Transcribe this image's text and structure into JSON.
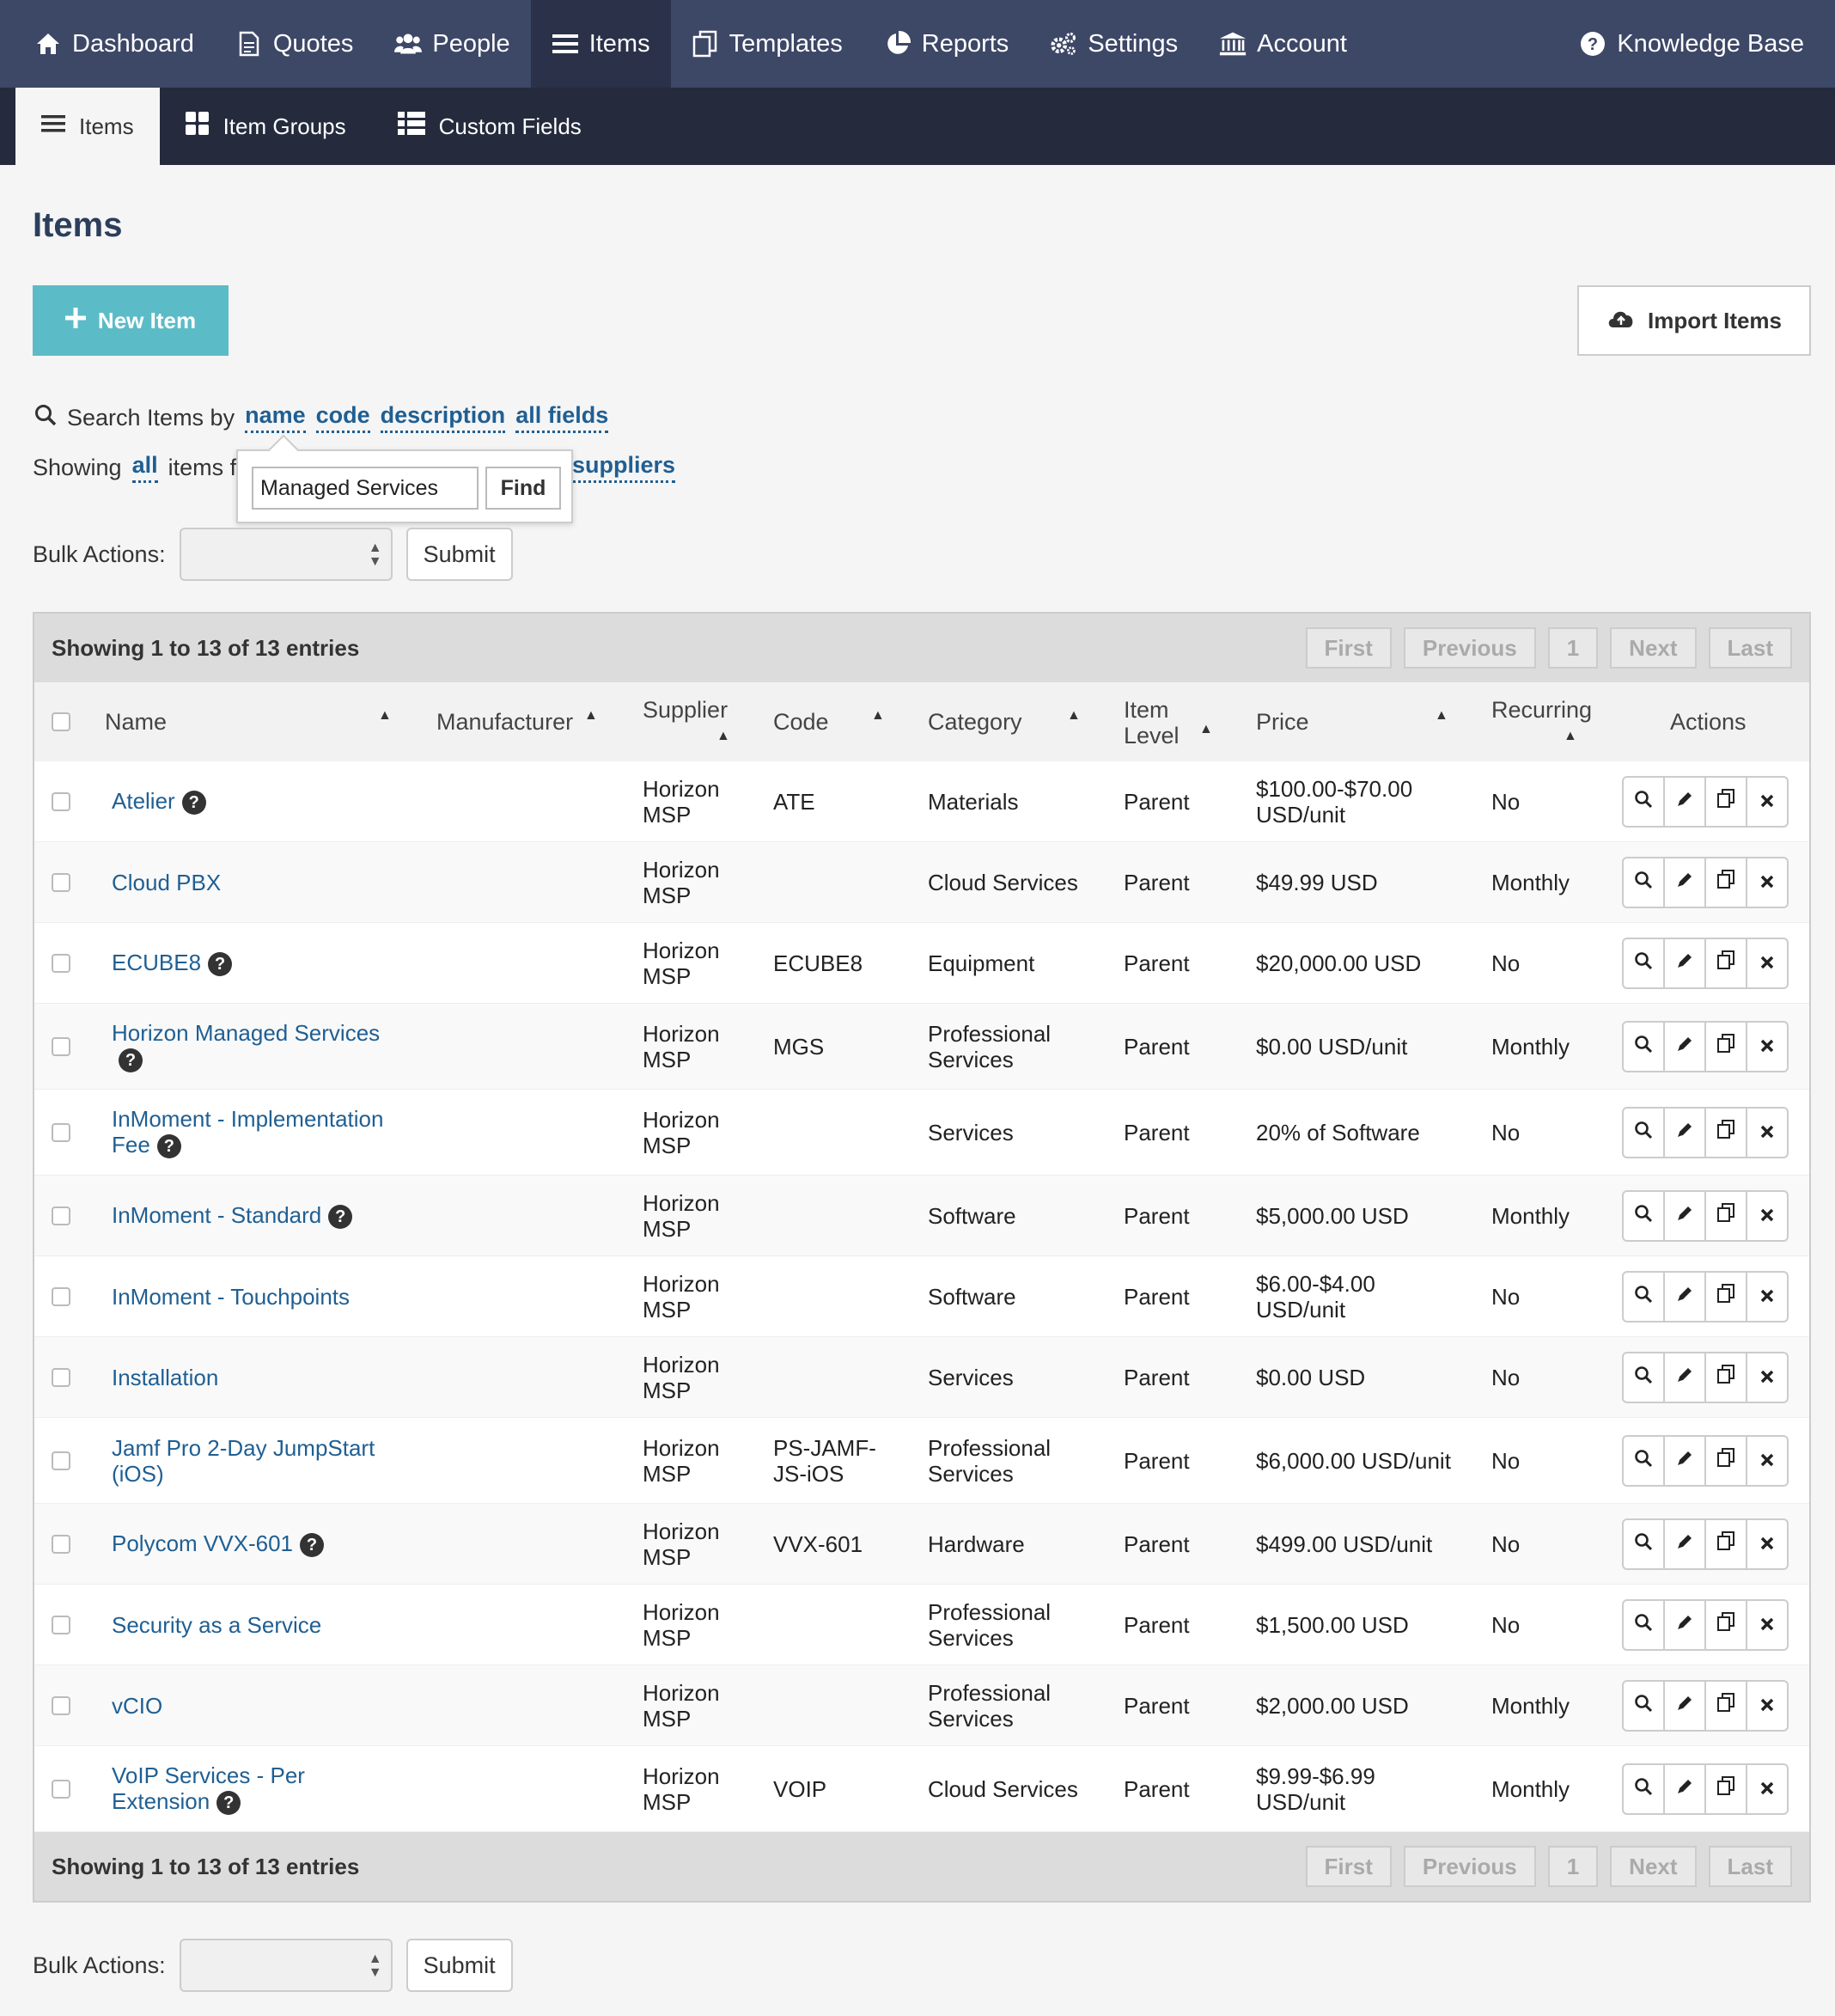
{
  "topnav": {
    "items": [
      {
        "label": "Dashboard",
        "icon": "home-icon"
      },
      {
        "label": "Quotes",
        "icon": "document-icon"
      },
      {
        "label": "People",
        "icon": "people-icon"
      },
      {
        "label": "Items",
        "icon": "list-icon",
        "active": true
      },
      {
        "label": "Templates",
        "icon": "templates-icon"
      },
      {
        "label": "Reports",
        "icon": "pie-chart-icon"
      },
      {
        "label": "Settings",
        "icon": "gears-icon"
      },
      {
        "label": "Account",
        "icon": "bank-icon"
      }
    ],
    "knowledge_base": "Knowledge Base"
  },
  "subnav": {
    "items": [
      {
        "label": "Items",
        "active": true
      },
      {
        "label": "Item Groups"
      },
      {
        "label": "Custom Fields"
      }
    ]
  },
  "page": {
    "title": "Items",
    "new_item": "New Item",
    "import_items": "Import Items"
  },
  "search": {
    "prefix": "Search Items by",
    "by": [
      "name",
      "code",
      "description",
      "all fields"
    ],
    "showing_prefix": "Showing",
    "showing_all": "all",
    "showing_mid": "items fr",
    "suppliers": "suppliers",
    "input_value": "Managed Services",
    "find_label": "Find"
  },
  "bulk": {
    "label": "Bulk Actions:",
    "submit": "Submit"
  },
  "table": {
    "info": "Showing 1 to 13 of 13 entries",
    "pager": [
      "First",
      "Previous",
      "1",
      "Next",
      "Last"
    ],
    "columns": {
      "name": "Name",
      "manufacturer": "Manufacturer",
      "supplier": "Supplier",
      "code": "Code",
      "category": "Category",
      "item_level_1": "Item",
      "item_level_2": "Level",
      "price": "Price",
      "recurring": "Recurring",
      "actions": "Actions"
    },
    "rows": [
      {
        "name": "Atelier",
        "help": true,
        "supplier1": "Horizon",
        "supplier2": "MSP",
        "code": "ATE",
        "code2": "",
        "cat1": "Materials",
        "cat2": "",
        "level": "Parent",
        "price1": "$100.00-$70.00",
        "price2": "USD/unit",
        "recurring": "No"
      },
      {
        "name": "Cloud PBX",
        "help": false,
        "supplier1": "Horizon",
        "supplier2": "MSP",
        "code": "",
        "code2": "",
        "cat1": "Cloud Services",
        "cat2": "",
        "level": "Parent",
        "price1": "$49.99 USD",
        "price2": "",
        "recurring": "Monthly"
      },
      {
        "name": "ECUBE8",
        "help": true,
        "supplier1": "Horizon",
        "supplier2": "MSP",
        "code": "ECUBE8",
        "code2": "",
        "cat1": "Equipment",
        "cat2": "",
        "level": "Parent",
        "price1": "$20,000.00 USD",
        "price2": "",
        "recurring": "No"
      },
      {
        "name": "Horizon Managed Services",
        "name2": "",
        "help": true,
        "help_newline": true,
        "supplier1": "Horizon",
        "supplier2": "MSP",
        "code": "MGS",
        "code2": "",
        "cat1": "Professional",
        "cat2": "Services",
        "level": "Parent",
        "price1": "$0.00 USD/unit",
        "price2": "",
        "recurring": "Monthly"
      },
      {
        "name": "InMoment - Implementation",
        "name2": "Fee",
        "help": true,
        "supplier1": "Horizon",
        "supplier2": "MSP",
        "code": "",
        "code2": "",
        "cat1": "Services",
        "cat2": "",
        "level": "Parent",
        "price1": "20% of Software",
        "price2": "",
        "recurring": "No"
      },
      {
        "name": "InMoment - Standard",
        "help": true,
        "supplier1": "Horizon",
        "supplier2": "MSP",
        "code": "",
        "code2": "",
        "cat1": "Software",
        "cat2": "",
        "level": "Parent",
        "price1": "$5,000.00 USD",
        "price2": "",
        "recurring": "Monthly"
      },
      {
        "name": "InMoment - Touchpoints",
        "help": false,
        "supplier1": "Horizon",
        "supplier2": "MSP",
        "code": "",
        "code2": "",
        "cat1": "Software",
        "cat2": "",
        "level": "Parent",
        "price1": "$6.00-$4.00",
        "price2": "USD/unit",
        "recurring": "No"
      },
      {
        "name": "Installation",
        "help": false,
        "supplier1": "Horizon",
        "supplier2": "MSP",
        "code": "",
        "code2": "",
        "cat1": "Services",
        "cat2": "",
        "level": "Parent",
        "price1": "$0.00 USD",
        "price2": "",
        "recurring": "No"
      },
      {
        "name": "Jamf Pro 2-Day JumpStart",
        "name2": "(iOS)",
        "help": false,
        "supplier1": "Horizon",
        "supplier2": "MSP",
        "code": "PS-JAMF-",
        "code2": "JS-iOS",
        "cat1": "Professional",
        "cat2": "Services",
        "level": "Parent",
        "price1": "$6,000.00 USD/unit",
        "price2": "",
        "recurring": "No"
      },
      {
        "name": "Polycom VVX-601",
        "help": true,
        "supplier1": "Horizon",
        "supplier2": "MSP",
        "code": "VVX-601",
        "code2": "",
        "cat1": "Hardware",
        "cat2": "",
        "level": "Parent",
        "price1": "$499.00 USD/unit",
        "price2": "",
        "recurring": "No"
      },
      {
        "name": "Security as a Service",
        "help": false,
        "supplier1": "Horizon",
        "supplier2": "MSP",
        "code": "",
        "code2": "",
        "cat1": "Professional",
        "cat2": "Services",
        "level": "Parent",
        "price1": "$1,500.00 USD",
        "price2": "",
        "recurring": "No"
      },
      {
        "name": "vCIO",
        "help": false,
        "supplier1": "Horizon",
        "supplier2": "MSP",
        "code": "",
        "code2": "",
        "cat1": "Professional",
        "cat2": "Services",
        "level": "Parent",
        "price1": "$2,000.00 USD",
        "price2": "",
        "recurring": "Monthly"
      },
      {
        "name": "VoIP Services - Per",
        "name2": "Extension",
        "help": true,
        "supplier1": "Horizon",
        "supplier2": "MSP",
        "code": "VOIP",
        "code2": "",
        "cat1": "Cloud Services",
        "cat2": "",
        "level": "Parent",
        "price1": "$9.99-$6.99",
        "price2": "USD/unit",
        "recurring": "Monthly"
      }
    ]
  },
  "colors": {
    "topnav": "#3d4766",
    "subnav": "#252b3d",
    "accent": "#5bbcc7",
    "link": "#1f5f93"
  }
}
